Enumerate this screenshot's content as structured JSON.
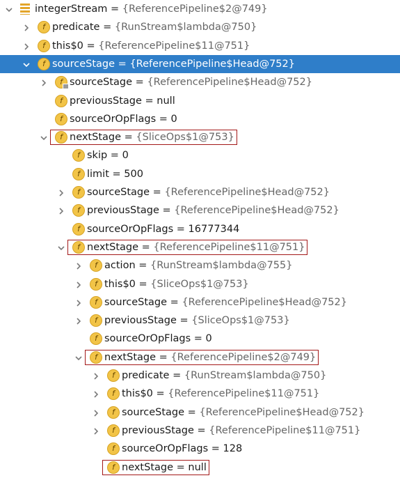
{
  "tree": {
    "nodes": [
      {
        "name": "integerStream",
        "eq": " = ",
        "value": "{ReferencePipeline$2@749}",
        "value_kind": "object",
        "expand": "down",
        "icon": "stream-icon",
        "depth": 0,
        "selected": false,
        "highlight": false
      },
      {
        "name": "predicate",
        "eq": " = ",
        "value": "{RunStream$lambda@750}",
        "value_kind": "object",
        "expand": "right",
        "icon": "field-icon",
        "depth": 1,
        "selected": false,
        "highlight": false
      },
      {
        "name": "this$0",
        "eq": " = ",
        "value": "{ReferencePipeline$11@751}",
        "value_kind": "object",
        "expand": "right",
        "icon": "field-icon",
        "depth": 1,
        "selected": false,
        "highlight": false
      },
      {
        "name": "sourceStage",
        "eq": " = ",
        "value": "{ReferencePipeline$Head@752}",
        "value_kind": "object",
        "expand": "down",
        "icon": "field-icon",
        "depth": 1,
        "selected": true,
        "highlight": false
      },
      {
        "name": "sourceStage",
        "eq": " = ",
        "value": "{ReferencePipeline$Head@752}",
        "value_kind": "object",
        "expand": "right",
        "icon": "field-lock-icon",
        "depth": 2,
        "selected": false,
        "highlight": false
      },
      {
        "name": "previousStage",
        "eq": " = ",
        "value": "null",
        "value_kind": "primitive",
        "expand": "none",
        "icon": "field-icon",
        "depth": 2,
        "selected": false,
        "highlight": false
      },
      {
        "name": "sourceOrOpFlags",
        "eq": " = ",
        "value": "0",
        "value_kind": "primitive",
        "expand": "none",
        "icon": "field-icon",
        "depth": 2,
        "selected": false,
        "highlight": false
      },
      {
        "name": "nextStage",
        "eq": " = ",
        "value": "{SliceOps$1@753}",
        "value_kind": "object",
        "expand": "down",
        "icon": "field-icon",
        "depth": 2,
        "selected": false,
        "highlight": true
      },
      {
        "name": "skip",
        "eq": " = ",
        "value": "0",
        "value_kind": "primitive",
        "expand": "none",
        "icon": "field-icon",
        "depth": 3,
        "selected": false,
        "highlight": false
      },
      {
        "name": "limit",
        "eq": " = ",
        "value": "500",
        "value_kind": "primitive",
        "expand": "none",
        "icon": "field-icon",
        "depth": 3,
        "selected": false,
        "highlight": false
      },
      {
        "name": "sourceStage",
        "eq": " = ",
        "value": "{ReferencePipeline$Head@752}",
        "value_kind": "object",
        "expand": "right",
        "icon": "field-icon",
        "depth": 3,
        "selected": false,
        "highlight": false
      },
      {
        "name": "previousStage",
        "eq": " = ",
        "value": "{ReferencePipeline$Head@752}",
        "value_kind": "object",
        "expand": "right",
        "icon": "field-icon",
        "depth": 3,
        "selected": false,
        "highlight": false
      },
      {
        "name": "sourceOrOpFlags",
        "eq": " = ",
        "value": "16777344",
        "value_kind": "primitive",
        "expand": "none",
        "icon": "field-icon",
        "depth": 3,
        "selected": false,
        "highlight": false
      },
      {
        "name": "nextStage",
        "eq": " = ",
        "value": "{ReferencePipeline$11@751}",
        "value_kind": "object",
        "expand": "down",
        "icon": "field-icon",
        "depth": 3,
        "selected": false,
        "highlight": true
      },
      {
        "name": "action",
        "eq": " = ",
        "value": "{RunStream$lambda@755}",
        "value_kind": "object",
        "expand": "right",
        "icon": "field-icon",
        "depth": 4,
        "selected": false,
        "highlight": false
      },
      {
        "name": "this$0",
        "eq": " = ",
        "value": "{SliceOps$1@753}",
        "value_kind": "object",
        "expand": "right",
        "icon": "field-icon",
        "depth": 4,
        "selected": false,
        "highlight": false
      },
      {
        "name": "sourceStage",
        "eq": " = ",
        "value": "{ReferencePipeline$Head@752}",
        "value_kind": "object",
        "expand": "right",
        "icon": "field-icon",
        "depth": 4,
        "selected": false,
        "highlight": false
      },
      {
        "name": "previousStage",
        "eq": " = ",
        "value": "{SliceOps$1@753}",
        "value_kind": "object",
        "expand": "right",
        "icon": "field-icon",
        "depth": 4,
        "selected": false,
        "highlight": false
      },
      {
        "name": "sourceOrOpFlags",
        "eq": " = ",
        "value": "0",
        "value_kind": "primitive",
        "expand": "none",
        "icon": "field-icon",
        "depth": 4,
        "selected": false,
        "highlight": false
      },
      {
        "name": "nextStage",
        "eq": " = ",
        "value": "{ReferencePipeline$2@749}",
        "value_kind": "object",
        "expand": "down",
        "icon": "field-icon",
        "depth": 4,
        "selected": false,
        "highlight": true
      },
      {
        "name": "predicate",
        "eq": " = ",
        "value": "{RunStream$lambda@750}",
        "value_kind": "object",
        "expand": "right",
        "icon": "field-icon",
        "depth": 5,
        "selected": false,
        "highlight": false
      },
      {
        "name": "this$0",
        "eq": " = ",
        "value": "{ReferencePipeline$11@751}",
        "value_kind": "object",
        "expand": "right",
        "icon": "field-icon",
        "depth": 5,
        "selected": false,
        "highlight": false
      },
      {
        "name": "sourceStage",
        "eq": " = ",
        "value": "{ReferencePipeline$Head@752}",
        "value_kind": "object",
        "expand": "right",
        "icon": "field-icon",
        "depth": 5,
        "selected": false,
        "highlight": false
      },
      {
        "name": "previousStage",
        "eq": " = ",
        "value": "{ReferencePipeline$11@751}",
        "value_kind": "object",
        "expand": "right",
        "icon": "field-icon",
        "depth": 5,
        "selected": false,
        "highlight": false
      },
      {
        "name": "sourceOrOpFlags",
        "eq": " = ",
        "value": "128",
        "value_kind": "primitive",
        "expand": "none",
        "icon": "field-icon",
        "depth": 5,
        "selected": false,
        "highlight": false
      },
      {
        "name": "nextStage",
        "eq": " = ",
        "value": "null",
        "value_kind": "primitive",
        "expand": "none",
        "icon": "field-icon",
        "depth": 5,
        "selected": false,
        "highlight": true
      }
    ]
  },
  "icons": {
    "field_glyph": "f"
  },
  "colors": {
    "selection": "#2f7ec9",
    "highlight_border": "#a31818",
    "field_icon": "#f2c447",
    "object_value": "#666666",
    "arrow": "#7a7a7a"
  }
}
